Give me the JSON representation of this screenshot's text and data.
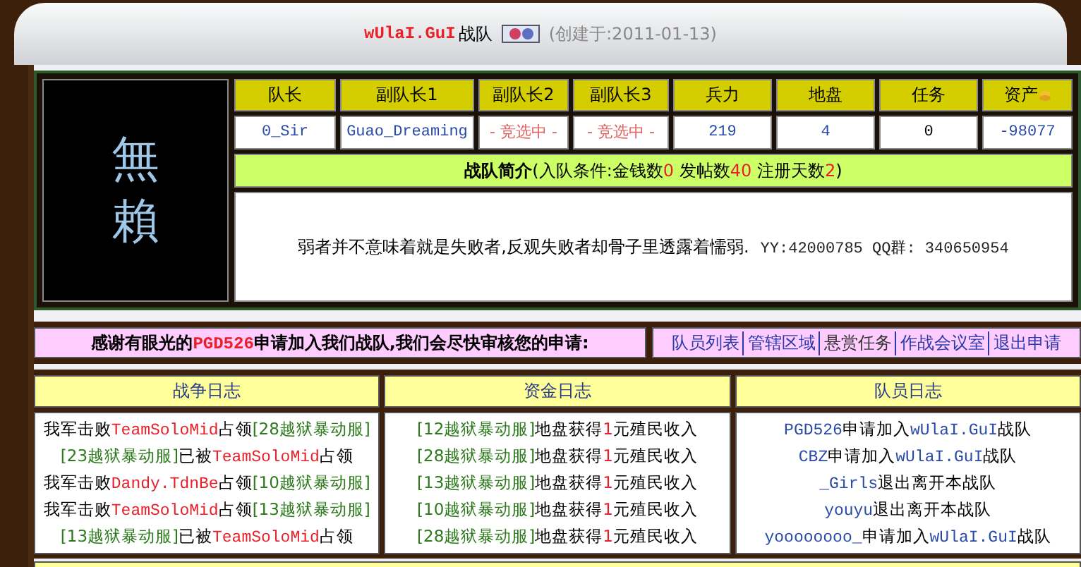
{
  "header": {
    "team_name": "wUlaI.GuI",
    "suffix": "战队",
    "created": "(创建于:2011-01-13)"
  },
  "emblem": {
    "chars": [
      "無",
      "賴"
    ]
  },
  "stats": {
    "columns": [
      "队长",
      "副队长1",
      "副队长2",
      "副队长3",
      "兵力",
      "地盘",
      "任务",
      "资产"
    ],
    "cells": [
      {
        "text": "0_Sir",
        "kind": "name"
      },
      {
        "text": "Guao_Dreaming",
        "kind": "name"
      },
      {
        "text": "- 竞选中 -",
        "kind": "vacant"
      },
      {
        "text": "- 竞选中 -",
        "kind": "vacant"
      },
      {
        "text": "219",
        "kind": "name"
      },
      {
        "text": "4",
        "kind": "name"
      },
      {
        "text": "0",
        "kind": "plain"
      },
      {
        "text": "-98077",
        "kind": "name"
      }
    ]
  },
  "intro": {
    "title": "战队简介",
    "conditions": [
      {
        "text": "(入队条件:金钱数",
        "kind": "plain"
      },
      {
        "text": "0",
        "kind": "num"
      },
      {
        "text": " 发帖数",
        "kind": "plain"
      },
      {
        "text": "40",
        "kind": "num"
      },
      {
        "text": " 注册天数",
        "kind": "plain"
      },
      {
        "text": "2",
        "kind": "num"
      },
      {
        "text": ")",
        "kind": "plain"
      }
    ],
    "motto": "弱者并不意味着就是失败者,反观失败者却骨子里透露着懦弱.",
    "contact": "YY:42000785 QQ群: 340650954"
  },
  "notice": {
    "parts": [
      {
        "text": "感谢有眼光的",
        "kind": "plain"
      },
      {
        "text": "PGD526",
        "kind": "team"
      },
      {
        "text": "申请加入我们战队,我们会尽快审核您的申请:",
        "kind": "plain"
      }
    ],
    "links": [
      {
        "label": "队员列表",
        "kind": "link"
      },
      {
        "label": "管辖区域",
        "kind": "link"
      },
      {
        "label": "悬赏任务",
        "kind": "plain"
      },
      {
        "label": "作战会议室",
        "kind": "link"
      },
      {
        "label": "退出申请",
        "kind": "link"
      }
    ]
  },
  "logs": [
    {
      "title": "战争日志",
      "entries": [
        [
          {
            "text": "我军击败",
            "kind": "plain"
          },
          {
            "text": "TeamSoloMid",
            "kind": "team"
          },
          {
            "text": "占领",
            "kind": "plain"
          },
          {
            "text": "[28越狱暴动服]",
            "kind": "server"
          }
        ],
        [
          {
            "text": "[23越狱暴动服]",
            "kind": "server"
          },
          {
            "text": "已被",
            "kind": "plain"
          },
          {
            "text": "TeamSoloMid",
            "kind": "team"
          },
          {
            "text": "占领",
            "kind": "plain"
          }
        ],
        [
          {
            "text": "我军击败",
            "kind": "plain"
          },
          {
            "text": "Dandy.TdnBe",
            "kind": "team"
          },
          {
            "text": "占领",
            "kind": "plain"
          },
          {
            "text": "[10越狱暴动服]",
            "kind": "server"
          }
        ],
        [
          {
            "text": "我军击败",
            "kind": "plain"
          },
          {
            "text": "TeamSoloMid",
            "kind": "team"
          },
          {
            "text": "占领",
            "kind": "plain"
          },
          {
            "text": "[13越狱暴动服]",
            "kind": "server"
          }
        ],
        [
          {
            "text": "[13越狱暴动服]",
            "kind": "server"
          },
          {
            "text": "已被",
            "kind": "plain"
          },
          {
            "text": "TeamSoloMid",
            "kind": "team"
          },
          {
            "text": "占领",
            "kind": "plain"
          }
        ]
      ]
    },
    {
      "title": "资金日志",
      "entries": [
        [
          {
            "text": "[12越狱暴动服]",
            "kind": "server"
          },
          {
            "text": "地盘获得",
            "kind": "plain"
          },
          {
            "text": "1",
            "kind": "num"
          },
          {
            "text": "元殖民收入",
            "kind": "plain"
          }
        ],
        [
          {
            "text": "[28越狱暴动服]",
            "kind": "server"
          },
          {
            "text": "地盘获得",
            "kind": "plain"
          },
          {
            "text": "1",
            "kind": "num"
          },
          {
            "text": "元殖民收入",
            "kind": "plain"
          }
        ],
        [
          {
            "text": "[13越狱暴动服]",
            "kind": "server"
          },
          {
            "text": "地盘获得",
            "kind": "plain"
          },
          {
            "text": "1",
            "kind": "num"
          },
          {
            "text": "元殖民收入",
            "kind": "plain"
          }
        ],
        [
          {
            "text": "[10越狱暴动服]",
            "kind": "server"
          },
          {
            "text": "地盘获得",
            "kind": "plain"
          },
          {
            "text": "1",
            "kind": "num"
          },
          {
            "text": "元殖民收入",
            "kind": "plain"
          }
        ],
        [
          {
            "text": "[28越狱暴动服]",
            "kind": "server"
          },
          {
            "text": "地盘获得",
            "kind": "plain"
          },
          {
            "text": "1",
            "kind": "num"
          },
          {
            "text": "元殖民收入",
            "kind": "plain"
          }
        ]
      ]
    },
    {
      "title": "队员日志",
      "entries": [
        [
          {
            "text": "PGD526",
            "kind": "user"
          },
          {
            "text": "申请加入",
            "kind": "plain"
          },
          {
            "text": "wUlaI.GuI",
            "kind": "user"
          },
          {
            "text": "战队",
            "kind": "plain"
          }
        ],
        [
          {
            "text": "CBZ",
            "kind": "user"
          },
          {
            "text": "申请加入",
            "kind": "plain"
          },
          {
            "text": "wUlaI.GuI",
            "kind": "user"
          },
          {
            "text": "战队",
            "kind": "plain"
          }
        ],
        [
          {
            "text": "_Girls",
            "kind": "user"
          },
          {
            "text": "退出离开本战队",
            "kind": "plain"
          }
        ],
        [
          {
            "text": "youyu",
            "kind": "user"
          },
          {
            "text": "退出离开本战队",
            "kind": "plain"
          }
        ],
        [
          {
            "text": "yoooooooo_",
            "kind": "user"
          },
          {
            "text": "申请加入",
            "kind": "plain"
          },
          {
            "text": "wUlaI.GuI",
            "kind": "user"
          },
          {
            "text": "战队",
            "kind": "plain"
          }
        ]
      ]
    }
  ]
}
